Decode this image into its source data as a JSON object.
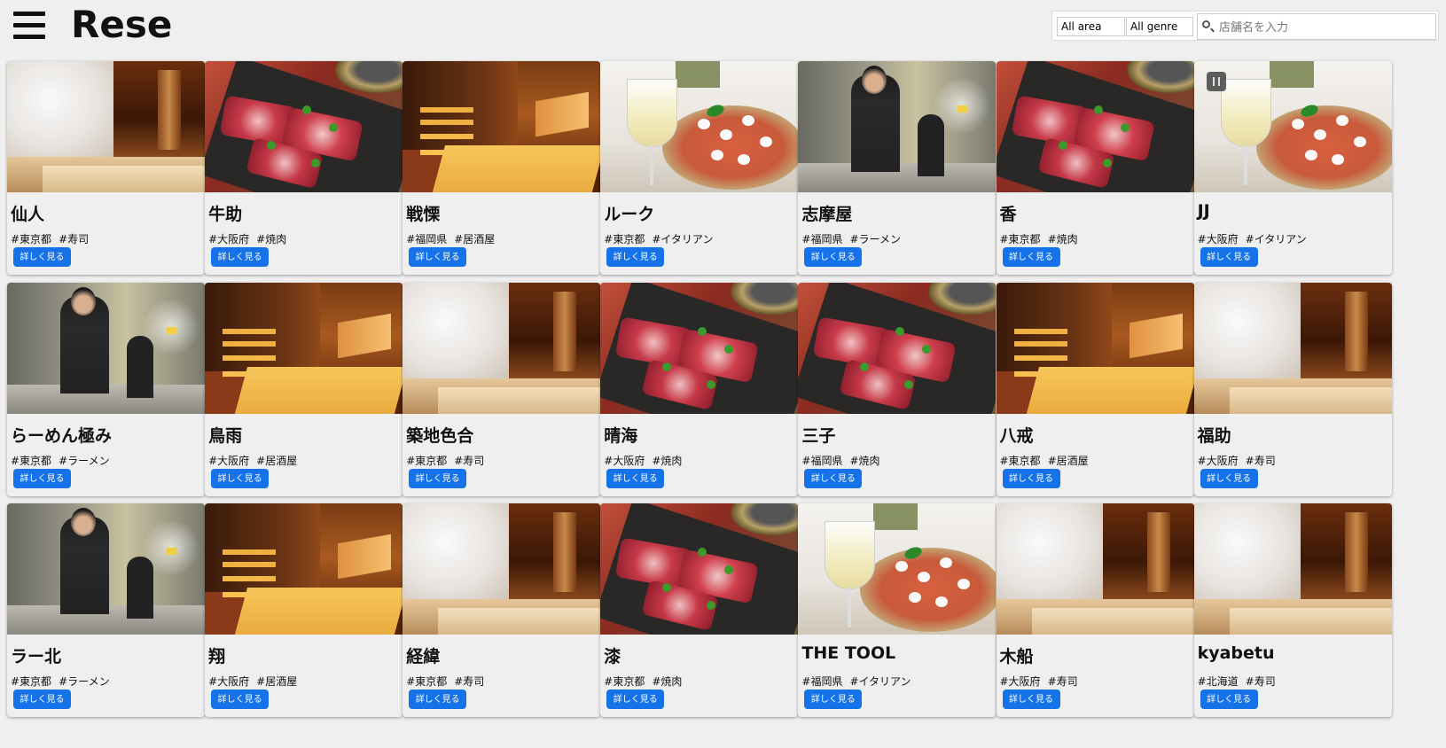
{
  "header": {
    "logo": "Rese",
    "area_select": "All area",
    "genre_select": "All genre",
    "search_placeholder": "店舗名を入力"
  },
  "card_button_label": "詳しく見る",
  "shops": [
    {
      "name": "仙人",
      "area": "#東京都",
      "genre": "#寿司",
      "photo": "sushi"
    },
    {
      "name": "牛助",
      "area": "#大阪府",
      "genre": "#焼肉",
      "photo": "meat"
    },
    {
      "name": "戦慄",
      "area": "#福岡県",
      "genre": "#居酒屋",
      "photo": "izakaya"
    },
    {
      "name": "ルーク",
      "area": "#東京都",
      "genre": "#イタリアン",
      "photo": "pizza"
    },
    {
      "name": "志摩屋",
      "area": "#福岡県",
      "genre": "#ラーメン",
      "photo": "ramen"
    },
    {
      "name": "香",
      "area": "#東京都",
      "genre": "#焼肉",
      "photo": "meat"
    },
    {
      "name": "JJ",
      "area": "#大阪府",
      "genre": "#イタリアン",
      "photo": "pizza"
    },
    {
      "name": "らーめん極み",
      "area": "#東京都",
      "genre": "#ラーメン",
      "photo": "ramen"
    },
    {
      "name": "鳥雨",
      "area": "#大阪府",
      "genre": "#居酒屋",
      "photo": "izakaya"
    },
    {
      "name": "築地色合",
      "area": "#東京都",
      "genre": "#寿司",
      "photo": "sushi"
    },
    {
      "name": "晴海",
      "area": "#大阪府",
      "genre": "#焼肉",
      "photo": "meat"
    },
    {
      "name": "三子",
      "area": "#福岡県",
      "genre": "#焼肉",
      "photo": "meat"
    },
    {
      "name": "八戒",
      "area": "#東京都",
      "genre": "#居酒屋",
      "photo": "izakaya"
    },
    {
      "name": "福助",
      "area": "#大阪府",
      "genre": "#寿司",
      "photo": "sushi"
    },
    {
      "name": "ラー北",
      "area": "#東京都",
      "genre": "#ラーメン",
      "photo": "ramen"
    },
    {
      "name": "翔",
      "area": "#大阪府",
      "genre": "#居酒屋",
      "photo": "izakaya"
    },
    {
      "name": "経緯",
      "area": "#東京都",
      "genre": "#寿司",
      "photo": "sushi"
    },
    {
      "name": "漆",
      "area": "#東京都",
      "genre": "#焼肉",
      "photo": "meat"
    },
    {
      "name": "THE TOOL",
      "area": "#福岡県",
      "genre": "#イタリアン",
      "photo": "pizza"
    },
    {
      "name": "木船",
      "area": "#大阪府",
      "genre": "#寿司",
      "photo": "sushi"
    },
    {
      "name": "kyabetu",
      "area": "#北海道",
      "genre": "#寿司",
      "photo": "sushi"
    }
  ],
  "colors": {
    "button": "#1572e8",
    "background": "#efefef"
  }
}
